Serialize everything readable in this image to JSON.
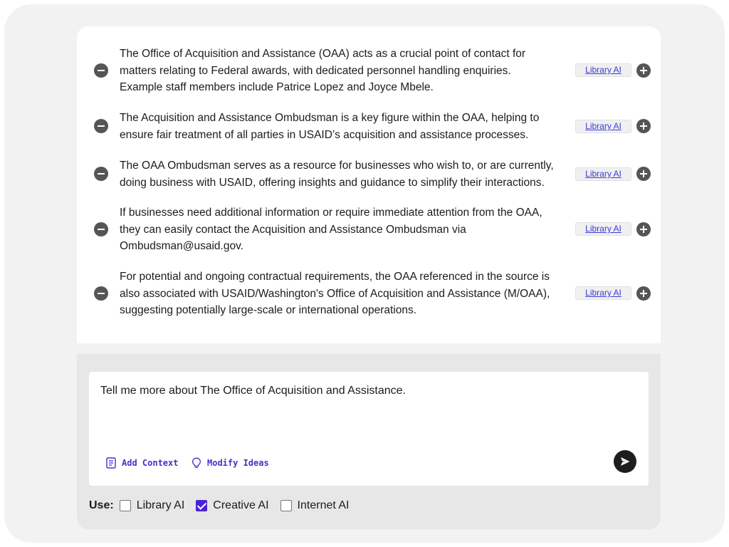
{
  "results": [
    {
      "lines": [
        "The Office of Acquisition and Assistance (OAA) acts as a crucial point of contact for",
        "matters relating to Federal awards, with dedicated personnel handling enquiries.",
        "Example staff members include Patrice Lopez and Joyce Mbele."
      ],
      "source": "Library AI"
    },
    {
      "lines": [
        "The Acquisition and Assistance Ombudsman is a key figure within the OAA, helping to",
        "ensure fair treatment of all parties in USAID’s acquisition and assistance processes."
      ],
      "source": "Library AI"
    },
    {
      "lines": [
        "The OAA Ombudsman serves as a resource for businesses who wish to, or are currently,",
        "doing business with USAID, offering insights and guidance to simplify their interactions."
      ],
      "source": "Library AI"
    },
    {
      "lines": [
        "If businesses need additional information or require immediate attention from the OAA,",
        "they can easily contact the Acquisition and Assistance Ombudsman via",
        "Ombudsman@usaid.gov."
      ],
      "source": "Library AI"
    },
    {
      "lines": [
        "For potential and ongoing contractual requirements, the OAA referenced in the source is",
        "also associated with USAID/Washington's Office of Acquisition and Assistance (M/OAA),",
        "suggesting potentially large-scale or international operations."
      ],
      "source": "Library AI"
    }
  ],
  "composer": {
    "prompt": "Tell me more about The Office of Acquisition and Assistance.",
    "add_context_label": "Add Context",
    "modify_ideas_label": "Modify Ideas",
    "send_icon": "send-icon"
  },
  "use": {
    "label": "Use:",
    "options": [
      {
        "label": "Library AI",
        "checked": false
      },
      {
        "label": "Creative AI",
        "checked": true
      },
      {
        "label": "Internet AI",
        "checked": false
      }
    ]
  },
  "colors": {
    "accent": "#4b22d6",
    "link": "#3d3ad6",
    "icon_dark": "#555555",
    "send_bg": "#1e1e1e"
  }
}
